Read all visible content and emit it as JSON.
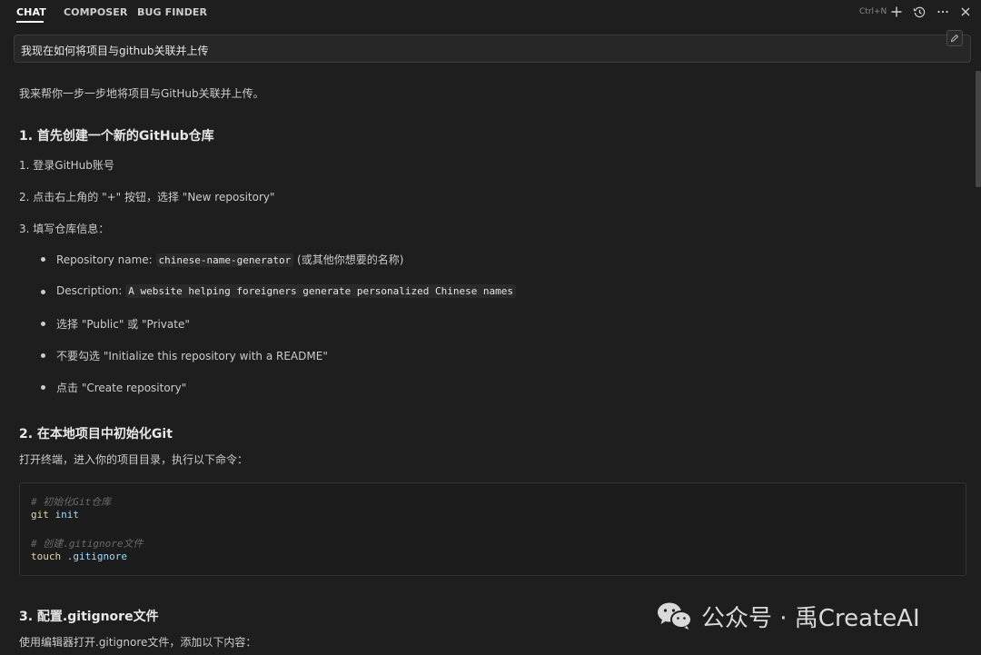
{
  "tabs": [
    "CHAT",
    "COMPOSER",
    "BUG FINDER"
  ],
  "toolbar": {
    "shortcut": "Ctrl+N",
    "icons": [
      "plus-icon",
      "history-icon",
      "ellipsis-icon",
      "close-icon"
    ]
  },
  "question": {
    "text": "我现在如何将项目与github关联并上传",
    "edit_icon": "pencil-icon"
  },
  "response": {
    "intro": "我来帮你一步一步地将项目与GitHub关联并上传。",
    "section1": {
      "heading": "1. 首先创建一个新的GitHub仓库",
      "steps": [
        "1. 登录GitHub账号",
        "2. 点击右上角的 \"+\" 按钮，选择 \"New repository\"",
        "3. 填写仓库信息："
      ],
      "bullets": [
        {
          "label": "Repository name: ",
          "code": "chinese-name-generator",
          "suffix": " (或其他你想要的名称)"
        },
        {
          "label": "Description: ",
          "code": "A website helping foreigners generate personalized Chinese names",
          "suffix": ""
        },
        {
          "label": "选择 \"Public\" 或 \"Private\"",
          "code": "",
          "suffix": ""
        },
        {
          "label": "不要勾选 \"Initialize this repository with a README\"",
          "code": "",
          "suffix": ""
        },
        {
          "label": "点击 \"Create repository\"",
          "code": "",
          "suffix": ""
        }
      ]
    },
    "section2": {
      "heading": "2. 在本地项目中初始化Git",
      "text": "打开终端，进入你的项目目录，执行以下命令：",
      "code": {
        "comment1": "# 初始化Git仓库",
        "cmd1": "git",
        "arg1": " init",
        "comment2": "# 创建.gitignore文件",
        "cmd2": "touch",
        "arg2": " .gitignore"
      }
    },
    "section3": {
      "heading": "3. 配置.gitignore文件",
      "text": "使用编辑器打开.gitignore文件，添加以下内容："
    }
  },
  "watermark": {
    "text": "公众号 · 禹CreateAI",
    "icon": "wechat-icon"
  }
}
